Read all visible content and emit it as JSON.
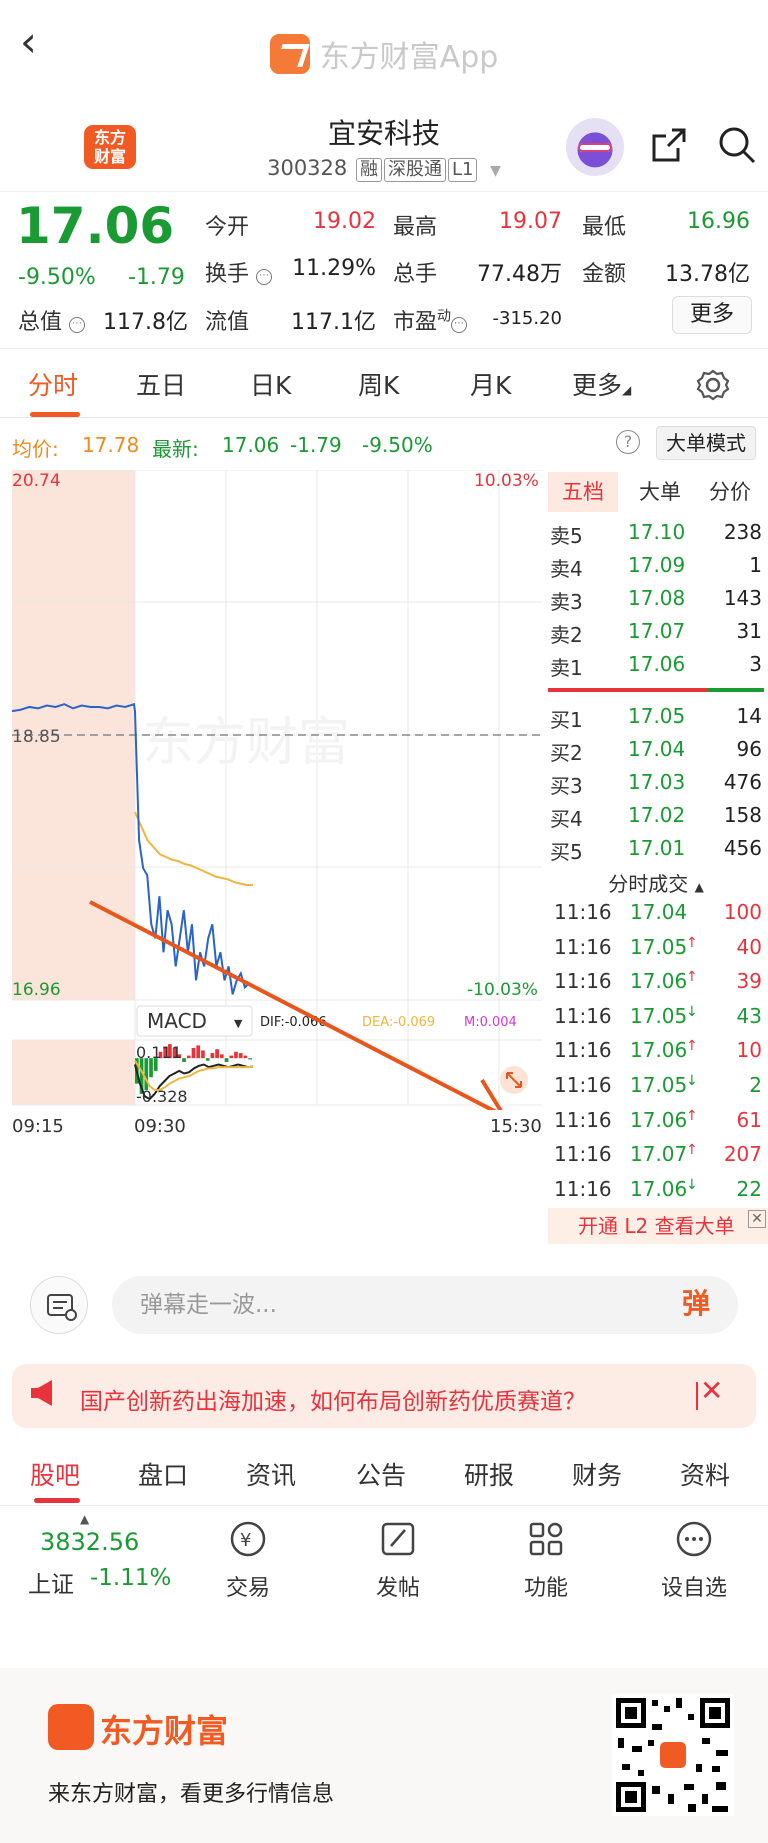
{
  "topbar": {
    "app_title": "东方财富App"
  },
  "header": {
    "badge_line1": "东方",
    "badge_line2": "财富",
    "stock_name": "宜安科技",
    "stock_code": "300328",
    "tags": [
      "融",
      "深股通",
      "L1"
    ]
  },
  "quote": {
    "price": "17.06",
    "change_pct": "-9.50%",
    "change": "-1.79",
    "rows": [
      [
        {
          "label": "今开",
          "value": "19.02",
          "color": "#e8333c"
        },
        {
          "label": "最高",
          "value": "19.07",
          "color": "#e8333c"
        },
        {
          "label": "最低",
          "value": "16.96",
          "color": "#1a9a33"
        }
      ],
      [
        {
          "label": "换手",
          "value": "11.29%",
          "color": "#222"
        },
        {
          "label": "总手",
          "value": "77.48万",
          "color": "#222"
        },
        {
          "label": "金额",
          "value": "13.78亿",
          "color": "#222"
        }
      ],
      [
        {
          "label": "总值",
          "value": "117.8亿",
          "color": "#222"
        },
        {
          "label": "流值",
          "value": "117.1亿",
          "color": "#222"
        },
        {
          "label": "市盈",
          "sup": "动",
          "value": "-315.20",
          "color": "#222"
        }
      ]
    ],
    "more_label": "更多"
  },
  "tabs": [
    "分时",
    "五日",
    "日K",
    "周K",
    "月K",
    "更多"
  ],
  "avgline": {
    "avg_label": "均价:",
    "avg_value": "17.78",
    "latest_label": "最新:",
    "latest_value": "17.06",
    "latest_change": "-1.79",
    "latest_pct": "-9.50%",
    "mode_button": "大单模式"
  },
  "chart_data": {
    "type": "line",
    "title": "",
    "xlabel": "",
    "ylabel": "",
    "ylim": [
      16.96,
      20.74
    ],
    "ymax_label": "20.74",
    "ymin_label": "16.96",
    "ymid_label": "18.85",
    "pct_top": "10.03%",
    "pct_bottom": "-10.03%",
    "x_labels": [
      "09:15",
      "09:30",
      "15:30"
    ],
    "watermark": "东方财富",
    "price_series": [
      19.02,
      19.03,
      19.05,
      19.04,
      19.06,
      19.05,
      19.07,
      19.04,
      19.06,
      19.05,
      19.05,
      19.04,
      19.06,
      19.05,
      19.07,
      19.02,
      18.1,
      17.9,
      17.85,
      17.5,
      17.4,
      17.7,
      17.3,
      17.6,
      17.5,
      17.2,
      17.4,
      17.6,
      17.3,
      17.5,
      17.1,
      17.3,
      17.2,
      17.4,
      17.5,
      17.2,
      17.3,
      17.1,
      17.2,
      17.0,
      17.1,
      17.15,
      17.05,
      17.08,
      17.06
    ],
    "avg_series": [
      18.3,
      18.2,
      18.1,
      18.05,
      18.0,
      17.98,
      17.96,
      17.95,
      17.93,
      17.92,
      17.9,
      17.88,
      17.86,
      17.84,
      17.83,
      17.82,
      17.8,
      17.79,
      17.78,
      17.78
    ],
    "macd": {
      "indicator": "MACD",
      "dif_label": "DIF:-0.066",
      "dea_label": "DEA:-0.069",
      "m_label": "M:0.004",
      "max_label": "0.111",
      "min_label": "-0.328",
      "bars": [
        -0.2,
        -0.28,
        -0.25,
        -0.15,
        -0.1,
        0.05,
        0.09,
        0.11,
        0.08,
        0.03,
        -0.03,
        0.02,
        0.08,
        0.1,
        0.06,
        -0.02,
        0.04,
        0.07,
        0.03,
        -0.03,
        0.02,
        0.05,
        0.04,
        0.02,
        -0.01
      ],
      "dif": [
        -0.05,
        -0.2,
        -0.3,
        -0.32,
        -0.28,
        -0.22,
        -0.18,
        -0.14,
        -0.12,
        -0.1,
        -0.12,
        -0.11,
        -0.08,
        -0.06,
        -0.05,
        -0.07,
        -0.06,
        -0.05,
        -0.06,
        -0.07,
        -0.06,
        -0.05,
        -0.06,
        -0.07,
        -0.066
      ],
      "dea": [
        -0.02,
        -0.08,
        -0.15,
        -0.22,
        -0.25,
        -0.25,
        -0.23,
        -0.2,
        -0.18,
        -0.16,
        -0.15,
        -0.14,
        -0.12,
        -0.1,
        -0.09,
        -0.08,
        -0.08,
        -0.07,
        -0.07,
        -0.07,
        -0.07,
        -0.07,
        -0.07,
        -0.069,
        -0.069
      ]
    }
  },
  "order_book": {
    "tabs": [
      "五档",
      "大单",
      "分价"
    ],
    "asks": [
      {
        "label": "卖5",
        "price": "17.10",
        "vol": "238"
      },
      {
        "label": "卖4",
        "price": "17.09",
        "vol": "1"
      },
      {
        "label": "卖3",
        "price": "17.08",
        "vol": "143"
      },
      {
        "label": "卖2",
        "price": "17.07",
        "vol": "31"
      },
      {
        "label": "卖1",
        "price": "17.06",
        "vol": "3"
      }
    ],
    "bids": [
      {
        "label": "买1",
        "price": "17.05",
        "vol": "14"
      },
      {
        "label": "买2",
        "price": "17.04",
        "vol": "96"
      },
      {
        "label": "买3",
        "price": "17.03",
        "vol": "476"
      },
      {
        "label": "买4",
        "price": "17.02",
        "vol": "158"
      },
      {
        "label": "买5",
        "price": "17.01",
        "vol": "456"
      }
    ],
    "ticks_title": "分时成交",
    "ticks": [
      {
        "time": "11:16",
        "price": "17.04",
        "arrow": "",
        "vol": "100",
        "vcolor": "#e8333c"
      },
      {
        "time": "11:16",
        "price": "17.05",
        "arrow": "↑",
        "vol": "40",
        "vcolor": "#e8333c"
      },
      {
        "time": "11:16",
        "price": "17.06",
        "arrow": "↑",
        "vol": "39",
        "vcolor": "#e8333c"
      },
      {
        "time": "11:16",
        "price": "17.05",
        "arrow": "↓",
        "vol": "43",
        "vcolor": "#1a9a33"
      },
      {
        "time": "11:16",
        "price": "17.06",
        "arrow": "↑",
        "vol": "10",
        "vcolor": "#e8333c"
      },
      {
        "time": "11:16",
        "price": "17.05",
        "arrow": "↓",
        "vol": "2",
        "vcolor": "#1a9a33"
      },
      {
        "time": "11:16",
        "price": "17.06",
        "arrow": "↑",
        "vol": "61",
        "vcolor": "#e8333c"
      },
      {
        "time": "11:16",
        "price": "17.07",
        "arrow": "↑",
        "vol": "207",
        "vcolor": "#e8333c"
      },
      {
        "time": "11:16",
        "price": "17.06",
        "arrow": "↓",
        "vol": "22",
        "vcolor": "#1a9a33"
      }
    ],
    "l2_promo": "开通 L2 查看大单"
  },
  "danmu": {
    "placeholder": "弹幕走一波...",
    "send_label": "弹"
  },
  "banner": {
    "text": "国产创新药出海加速，如何布局创新药优质赛道？",
    "close": "✕"
  },
  "subtabs": [
    "股吧",
    "盘口",
    "资讯",
    "公告",
    "研报",
    "财务",
    "资料"
  ],
  "dock": {
    "index_value": "3832.56",
    "index_name": "上证",
    "index_change": "-1.11%",
    "items": [
      {
        "label": "交易",
        "icon": "exchange-icon"
      },
      {
        "label": "发帖",
        "icon": "post-icon"
      },
      {
        "label": "功能",
        "icon": "apps-icon"
      },
      {
        "label": "设自选",
        "icon": "more-icon"
      }
    ]
  },
  "footer": {
    "brand": "东方财富",
    "slogan": "来东方财富，看更多行情信息"
  },
  "colors": {
    "up": "#e8333c",
    "down": "#1a9a33",
    "brand": "#f15a22",
    "price_line": "#2a63c9",
    "avg_line": "#f0b53c"
  }
}
